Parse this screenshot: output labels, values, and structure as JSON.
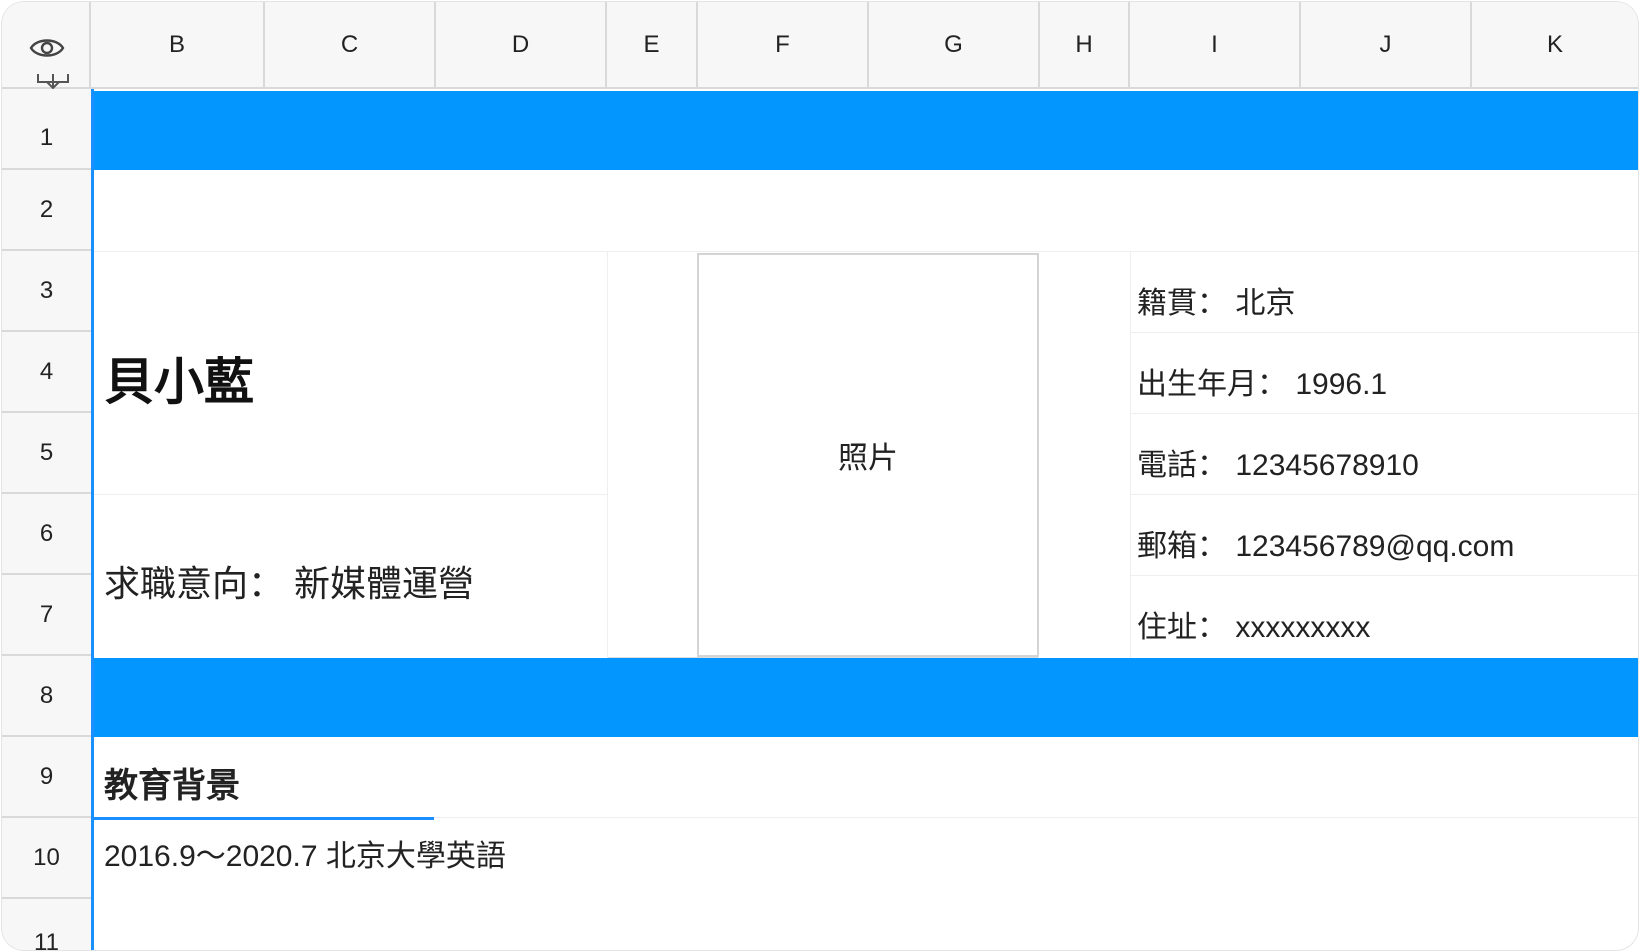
{
  "columns": [
    "B",
    "C",
    "D",
    "E",
    "F",
    "G",
    "H",
    "I",
    "J",
    "K"
  ],
  "rows": [
    "1",
    "2",
    "3",
    "4",
    "5",
    "6",
    "7",
    "8",
    "9",
    "10",
    "11"
  ],
  "colors": {
    "band": "#0396fe",
    "selection": "#1a8fff",
    "header_bg": "#f7f7f7"
  },
  "icons": {
    "visibility": "eye-icon",
    "freeze": "collapse-rows-icon"
  },
  "resume": {
    "name": "貝小藍",
    "intent": "求職意向：  新媒體運營",
    "photo": "照片",
    "info": [
      "籍貫：  北京",
      "出生年月：  1996.1",
      "電話：  12345678910",
      "郵箱：   123456789@qq.com",
      "住址：   xxxxxxxxx"
    ],
    "education_title": "教育背景",
    "education_entry": "2016.9～2020.7 北京大學英語"
  }
}
